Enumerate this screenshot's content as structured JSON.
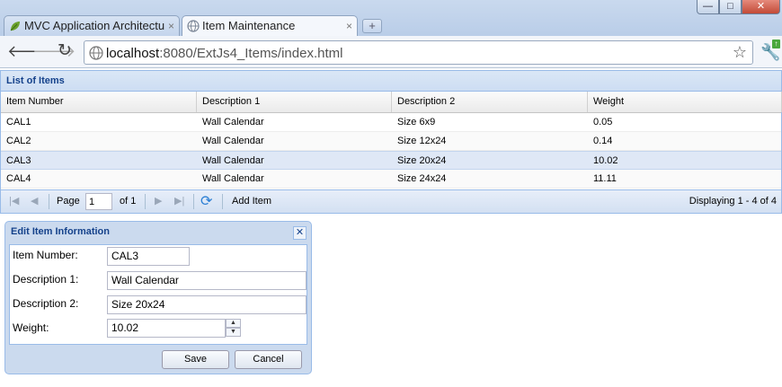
{
  "browser": {
    "tabs": [
      {
        "label": "MVC Application Architectu",
        "close": "×"
      },
      {
        "label": "Item Maintenance",
        "close": "×"
      }
    ],
    "new_tab": "+",
    "window_buttons": {
      "minimize": "—",
      "maximize": "□",
      "close": "✕"
    },
    "url_host": "localhost",
    "url_path": ":8080/ExtJs4_Items/index.html",
    "icons": {
      "back": "back-arrow-icon",
      "forward": "forward-arrow-icon",
      "reload": "reload-icon",
      "star": "bookmark-star-icon",
      "wrench": "wrench-icon"
    }
  },
  "grid": {
    "title": "List of Items",
    "columns": [
      "Item Number",
      "Description 1",
      "Description 2",
      "Weight"
    ],
    "rows": [
      [
        "CAL1",
        "Wall Calendar",
        "Size 6x9",
        "0.05"
      ],
      [
        "CAL2",
        "Wall Calendar",
        "Size 12x24",
        "0.14"
      ],
      [
        "CAL3",
        "Wall Calendar",
        "Size 20x24",
        "10.02"
      ],
      [
        "CAL4",
        "Wall Calendar",
        "Size 24x24",
        "11.11"
      ]
    ],
    "selected_row": 2,
    "pager": {
      "page_label": "Page",
      "page_value": "1",
      "of_label": "of 1",
      "add_item": "Add Item",
      "display_info": "Displaying 1 - 4 of 4"
    }
  },
  "edit_window": {
    "title": "Edit Item Information",
    "close": "✕",
    "fields": [
      {
        "label": "Item Number:",
        "value": "CAL3"
      },
      {
        "label": "Description 1:",
        "value": "Wall Calendar"
      },
      {
        "label": "Description 2:",
        "value": "Size 20x24"
      },
      {
        "label": "Weight:",
        "value": "10.02"
      }
    ],
    "save": "Save",
    "cancel": "Cancel"
  },
  "colors": {
    "header_text": "#15428b",
    "selected_row": "#dfe8f6",
    "panel_border": "#99bbe8"
  }
}
